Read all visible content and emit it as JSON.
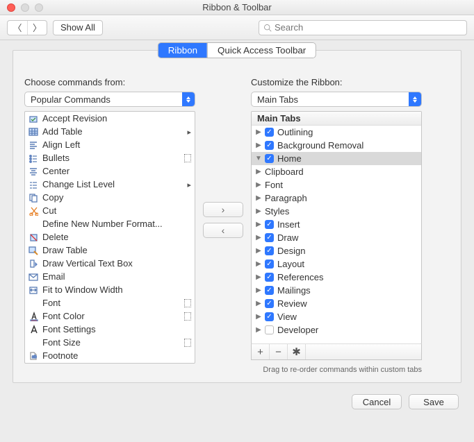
{
  "window": {
    "title": "Ribbon & Toolbar"
  },
  "toolbar": {
    "show_all": "Show All",
    "search_placeholder": "Search"
  },
  "tabs": {
    "ribbon": "Ribbon",
    "quick": "Quick Access Toolbar",
    "active": "ribbon"
  },
  "left": {
    "label": "Choose commands from:",
    "combo": "Popular Commands",
    "items": [
      {
        "text": "Accept Revision",
        "submenu": false,
        "menuind": false,
        "icon": "accept"
      },
      {
        "text": "Add Table",
        "submenu": true,
        "menuind": false,
        "icon": "table"
      },
      {
        "text": "Align Left",
        "submenu": false,
        "menuind": false,
        "icon": "align"
      },
      {
        "text": "Bullets",
        "submenu": false,
        "menuind": true,
        "icon": "bullets"
      },
      {
        "text": "Center",
        "submenu": false,
        "menuind": false,
        "icon": "center"
      },
      {
        "text": "Change List Level",
        "submenu": true,
        "menuind": false,
        "icon": "listlevel"
      },
      {
        "text": "Copy",
        "submenu": false,
        "menuind": false,
        "icon": "copy"
      },
      {
        "text": "Cut",
        "submenu": false,
        "menuind": false,
        "icon": "cut"
      },
      {
        "text": "Define New Number Format...",
        "submenu": false,
        "menuind": false,
        "icon": ""
      },
      {
        "text": "Delete",
        "submenu": false,
        "menuind": false,
        "icon": "delete"
      },
      {
        "text": "Draw Table",
        "submenu": false,
        "menuind": false,
        "icon": "drawtable"
      },
      {
        "text": "Draw Vertical Text Box",
        "submenu": false,
        "menuind": false,
        "icon": "vtextbox"
      },
      {
        "text": "Email",
        "submenu": false,
        "menuind": false,
        "icon": "email"
      },
      {
        "text": "Fit to Window Width",
        "submenu": false,
        "menuind": false,
        "icon": "fit"
      },
      {
        "text": "Font",
        "submenu": false,
        "menuind": true,
        "icon": ""
      },
      {
        "text": "Font Color",
        "submenu": false,
        "menuind": true,
        "icon": "fontcolor"
      },
      {
        "text": "Font Settings",
        "submenu": false,
        "menuind": false,
        "icon": "fontsettings"
      },
      {
        "text": "Font Size",
        "submenu": false,
        "menuind": true,
        "icon": ""
      },
      {
        "text": "Footnote",
        "submenu": false,
        "menuind": false,
        "icon": "footnote"
      }
    ]
  },
  "right": {
    "label": "Customize the Ribbon:",
    "combo": "Main Tabs",
    "header": "Main Tabs",
    "nodes": [
      {
        "text": "Outlining",
        "checked": true,
        "expanded": false,
        "selected": false,
        "level": 0
      },
      {
        "text": "Background Removal",
        "checked": true,
        "expanded": false,
        "selected": false,
        "level": 0
      },
      {
        "text": "Home",
        "checked": true,
        "expanded": true,
        "selected": true,
        "level": 0
      },
      {
        "text": "Clipboard",
        "checked": null,
        "expanded": false,
        "selected": false,
        "level": 1
      },
      {
        "text": "Font",
        "checked": null,
        "expanded": false,
        "selected": false,
        "level": 1
      },
      {
        "text": "Paragraph",
        "checked": null,
        "expanded": false,
        "selected": false,
        "level": 1
      },
      {
        "text": "Styles",
        "checked": null,
        "expanded": false,
        "selected": false,
        "level": 1
      },
      {
        "text": "Insert",
        "checked": true,
        "expanded": false,
        "selected": false,
        "level": 0
      },
      {
        "text": "Draw",
        "checked": true,
        "expanded": false,
        "selected": false,
        "level": 0
      },
      {
        "text": "Design",
        "checked": true,
        "expanded": false,
        "selected": false,
        "level": 0
      },
      {
        "text": "Layout",
        "checked": true,
        "expanded": false,
        "selected": false,
        "level": 0
      },
      {
        "text": "References",
        "checked": true,
        "expanded": false,
        "selected": false,
        "level": 0
      },
      {
        "text": "Mailings",
        "checked": true,
        "expanded": false,
        "selected": false,
        "level": 0
      },
      {
        "text": "Review",
        "checked": true,
        "expanded": false,
        "selected": false,
        "level": 0
      },
      {
        "text": "View",
        "checked": true,
        "expanded": false,
        "selected": false,
        "level": 0
      },
      {
        "text": "Developer",
        "checked": false,
        "expanded": false,
        "selected": false,
        "level": 0
      }
    ],
    "hint": "Drag to re-order commands within custom tabs"
  },
  "footer": {
    "cancel": "Cancel",
    "save": "Save"
  },
  "iconsvg": {
    "accept": "<path d='M2 4h10v8H2z' fill='#cfe3ff' stroke='#5a7db5'/><path d='M4 8l2 2 4-4' stroke='#3c8f3c'/>",
    "table": "<rect x='1' y='2' width='12' height='10' fill='#cfe3ff' stroke='#5a7db5'/><path d='M1 6h12M1 9h12M5 2v10M9 2v10' stroke='#5a7db5'/>",
    "align": "<path d='M2 3h10M2 6h7M2 9h10M2 12h7' stroke='#5a7db5' stroke-width='1.5'/>",
    "bullets": "<circle cx='3' cy='4' r='1.3' fill='#5a7db5'/><circle cx='3' cy='8' r='1.3' fill='#5a7db5'/><circle cx='3' cy='12' r='1.3' fill='#5a7db5'/><path d='M6 4h6M6 8h6M6 12h6' stroke='#5a7db5'/>",
    "center": "<path d='M2 3h10M4 6h6M2 9h10M4 12h6' stroke='#5a7db5' stroke-width='1.5'/>",
    "listlevel": "<path d='M2 4h3M6 4h6M2 8h3M6 8h6M2 12h3M6 12h6' stroke='#5a7db5'/>",
    "copy": "<rect x='2' y='2' width='7' height='9' fill='#fff' stroke='#5a7db5'/><rect x='5' y='4' width='7' height='9' fill='#fff' stroke='#5a7db5'/>",
    "cut": "<path d='M4 2l8 10M12 2L4 12' stroke='#e67e22'/><circle cx='4' cy='12' r='2' stroke='#e67e22'/><circle cx='12' cy='12' r='2' stroke='#e67e22'/>",
    "delete": "<rect x='3' y='3' width='9' height='9' fill='#cfe3ff' stroke='#5a7db5'/><path d='M3 3l9 9' stroke='#d33'/>",
    "drawtable": "<rect x='1' y='2' width='9' height='8' fill='#cfe3ff' stroke='#5a7db5'/><path d='M8 8l5 5' stroke='#d98b2b' stroke-width='2'/>",
    "vtextbox": "<rect x='3' y='2' width='5' height='10' fill='#fff' stroke='#5a7db5'/><path d='M10 6v4l2-2z' fill='#5a7db5'/>",
    "email": "<rect x='1' y='3' width='12' height='9' fill='#fff' stroke='#5a7db5'/><path d='M1 3l6 5 6-5' stroke='#5a7db5'/>",
    "fit": "<rect x='2' y='3' width='10' height='9' stroke='#5a7db5' fill='none'/><path d='M2 7h10M5 5l-2 2 2 2M9 5l2 2-2 2' stroke='#5a7db5'/>",
    "fontcolor": "<path d='M5 11L8 2l3 9M6 8h4' stroke='#333'/><rect x='3' y='12' width='10' height='2' fill='#d33'/>",
    "fontsettings": "<path d='M4 12L8 2l4 10M5 9h6' stroke='#333' stroke-width='1.5'/>",
    "footnote": "<path d='M3 2h5l3 3v7H3z' fill='#fff' stroke='#999'/><text x='5' y='10' font-size='6' fill='#999'>ab</text>"
  }
}
